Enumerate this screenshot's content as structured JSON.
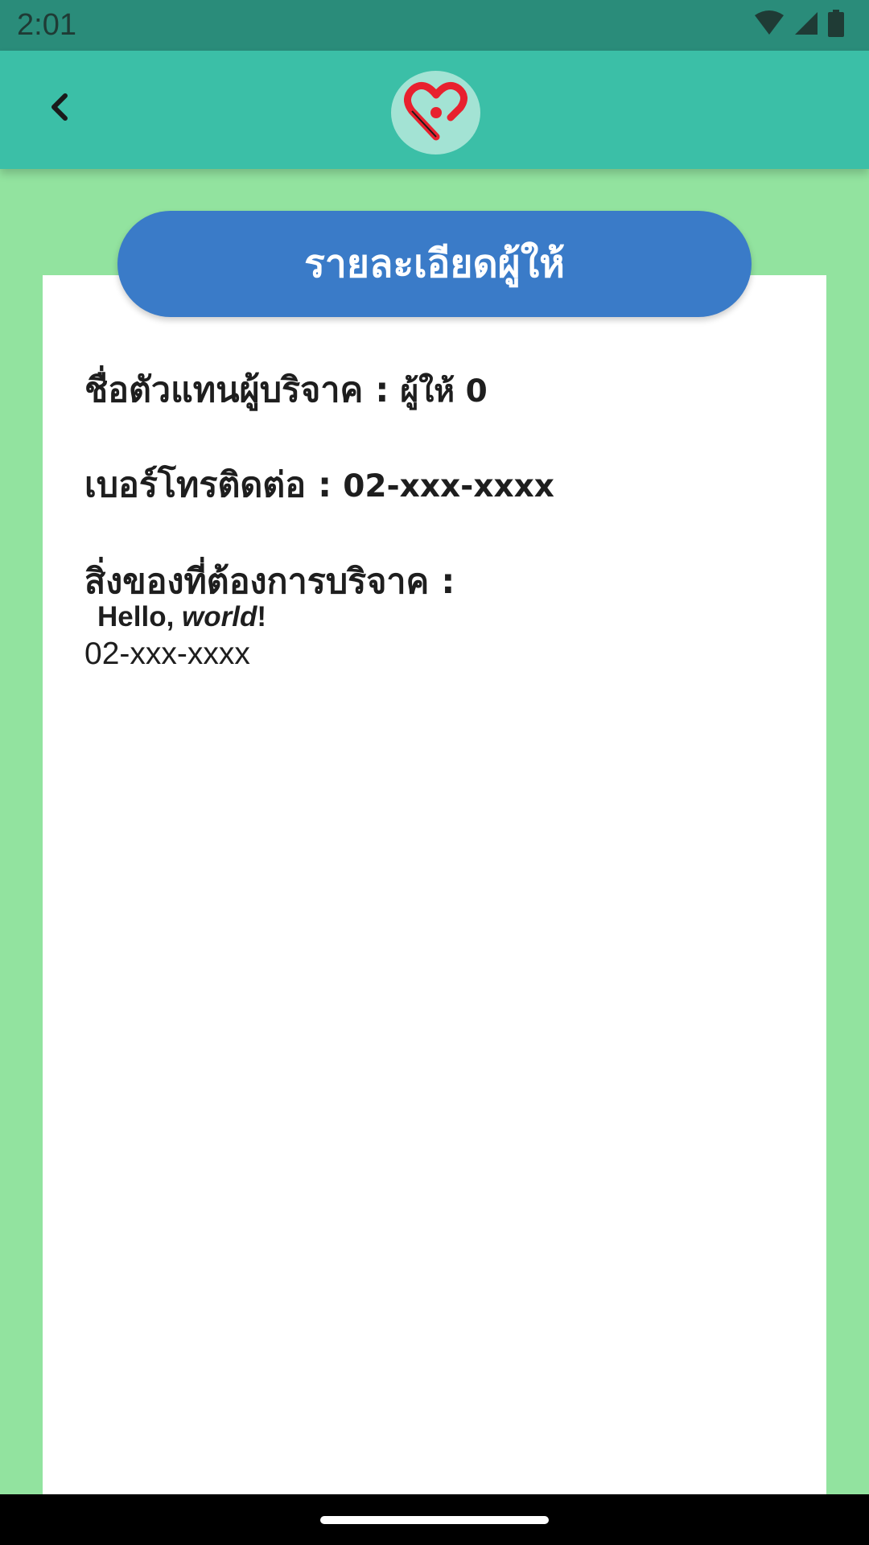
{
  "status_bar": {
    "time": "2:01",
    "icons": [
      "wifi-icon",
      "cell-signal-icon",
      "battery-icon"
    ]
  },
  "app_bar": {
    "back_icon": "chevron-left-icon",
    "logo_icon": "heart-logo-icon"
  },
  "card": {
    "title": "รายละเอียดผู้ให้",
    "donor_name_label": "ชื่อตัวแทนผู้บริจาค :",
    "donor_name_value": "ผู้ให้ 0",
    "phone_label": "เบอร์โทรติดต่อ :",
    "phone_value": "02-xxx-xxxx",
    "items_label": "สิ่งของที่ต้องการบริจาค :",
    "items_hello": "Hello, ",
    "items_world": "world",
    "items_exclaim": "!",
    "items_phone": "02-xxx-xxxx"
  },
  "colors": {
    "background": "#92e39f",
    "status_bar": "#2a8c7a",
    "app_bar": "#3bbfa7",
    "title_pill": "#3a7bc8",
    "logo_heart": "#e8212e"
  }
}
